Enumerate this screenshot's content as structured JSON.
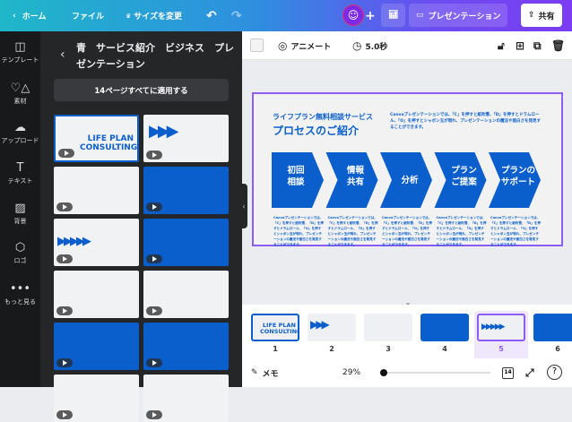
{
  "topbar": {
    "home": "ホーム",
    "file": "ファイル",
    "resize": "サイズを変更",
    "present": "プレゼンテーション",
    "share": "共有"
  },
  "rail": [
    {
      "label": "テンプレート",
      "icon": "layout-icon"
    },
    {
      "label": "素材",
      "icon": "elements-icon"
    },
    {
      "label": "アップロード",
      "icon": "cloud-upload-icon"
    },
    {
      "label": "テキスト",
      "icon": "text-icon"
    },
    {
      "label": "背景",
      "icon": "background-icon"
    },
    {
      "label": "ロゴ",
      "icon": "logo-icon"
    },
    {
      "label": "もっと見る",
      "icon": "more-icon"
    }
  ],
  "panel": {
    "title": "青　サービス紹介　ビジネス　プレゼンテーション",
    "apply": "14ページすべてに適用する",
    "thumb1_title": "LIFE PLAN CONSULTING"
  },
  "toolbar": {
    "animate": "アニメート",
    "duration": "5.0秒"
  },
  "slide": {
    "subtitle": "ライフプラン無料相談サービス",
    "title": "プロセスのご紹介",
    "description": "Canvaプレゼンテーションでは、「C」を押すと紙吹雪、「D」を押すとドラムロール、「O」を押すとシャボン玉が現れ、プレゼンテーションの魔法や面白さを発見することができます。",
    "steps": [
      {
        "label": "初回\n相談"
      },
      {
        "label": "情報\n共有"
      },
      {
        "label": "分析"
      },
      {
        "label": "プラン\nご提案"
      },
      {
        "label": "プランの\nサポート"
      }
    ],
    "step_body": "Canvaプレゼンテーションでは、「C」を押すと紙吹雪、「D」を押すとドラムロール、「O」を押すとシャボン玉が現れ、プレゼンテーションの魔法や面白さを発見することができます。"
  },
  "pages": [
    "1",
    "2",
    "3",
    "4",
    "5",
    "6"
  ],
  "page_thumb1": "LIFE PLAN CONSULTING",
  "footer": {
    "notes": "メモ",
    "zoom": "29%",
    "page_count": "14"
  },
  "colors": {
    "accent": "#0b5fcc",
    "selection": "#8b5cf6"
  }
}
